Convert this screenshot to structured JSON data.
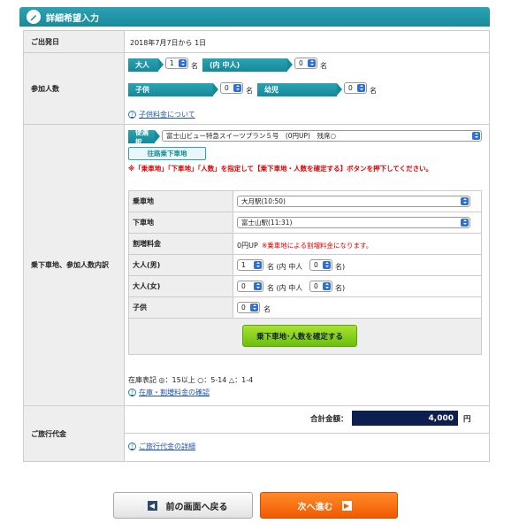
{
  "header": {
    "title": "詳細希望入力"
  },
  "departure": {
    "label": "ご出発日",
    "value": "2018年7月7日から 1日"
  },
  "participants": {
    "label": "参加人数",
    "adult_tag": "大人",
    "adult_value": "1",
    "adult_unit": "名",
    "adult_in_tag": "(内 中人)",
    "adult_in_value": "0",
    "adult_in_unit": "名",
    "child_tag": "子供",
    "child_value": "0",
    "child_unit": "名",
    "infant_tag": "幼児",
    "infant_value": "0",
    "infant_unit": "名",
    "child_fee_link": "子供料金について"
  },
  "boarding": {
    "label": "乗下車地、参加人数内訳",
    "bin_tag": "便選択",
    "bin_value": "富士山ビュー特急スイーツプラン５号　(0円UP)　残席○",
    "route_button": "往路乗下車地",
    "warning": "※「乗車地」「下車地」「人数」を指定して【乗下車地・人数を確定する】ボタンを押下してください。",
    "rows": {
      "board_label": "乗車地",
      "board_value": "大月駅(10:50)",
      "alight_label": "下車地",
      "alight_value": "富士山駅(11:31)",
      "surcharge_label": "割増料金",
      "surcharge_value": "0円UP",
      "surcharge_note": "※乗車地による割増料金になります。",
      "male_label": "大人(男)",
      "male_value": "1",
      "male_mid": "名 (内 中人",
      "male_in_value": "0",
      "male_end": "名)",
      "female_label": "大人(女)",
      "female_value": "0",
      "female_mid": "名 (内 中人",
      "female_in_value": "0",
      "female_end": "名)",
      "child_label": "子供",
      "child_value": "0",
      "child_unit": "名"
    },
    "confirm_button": "乗下車地･人数を確定する",
    "stock_note": "在庫表記 ◎：15以上 ○：5-14 △：1-4",
    "stock_link": "在庫・割増料金の確認"
  },
  "price": {
    "label": "ご旅行代金",
    "total_label": "合計金額：",
    "total_value": "4,000",
    "total_unit": "円",
    "detail_link": "ご旅行代金の詳細"
  },
  "nav": {
    "back_label": "前の画面へ戻る",
    "next_label": "次へ進む"
  },
  "colors": {
    "teal": "#1a8a9a",
    "orange": "#f05a00",
    "green": "#6cbf10",
    "navy": "#0d1f4f",
    "warning": "#e00000"
  }
}
